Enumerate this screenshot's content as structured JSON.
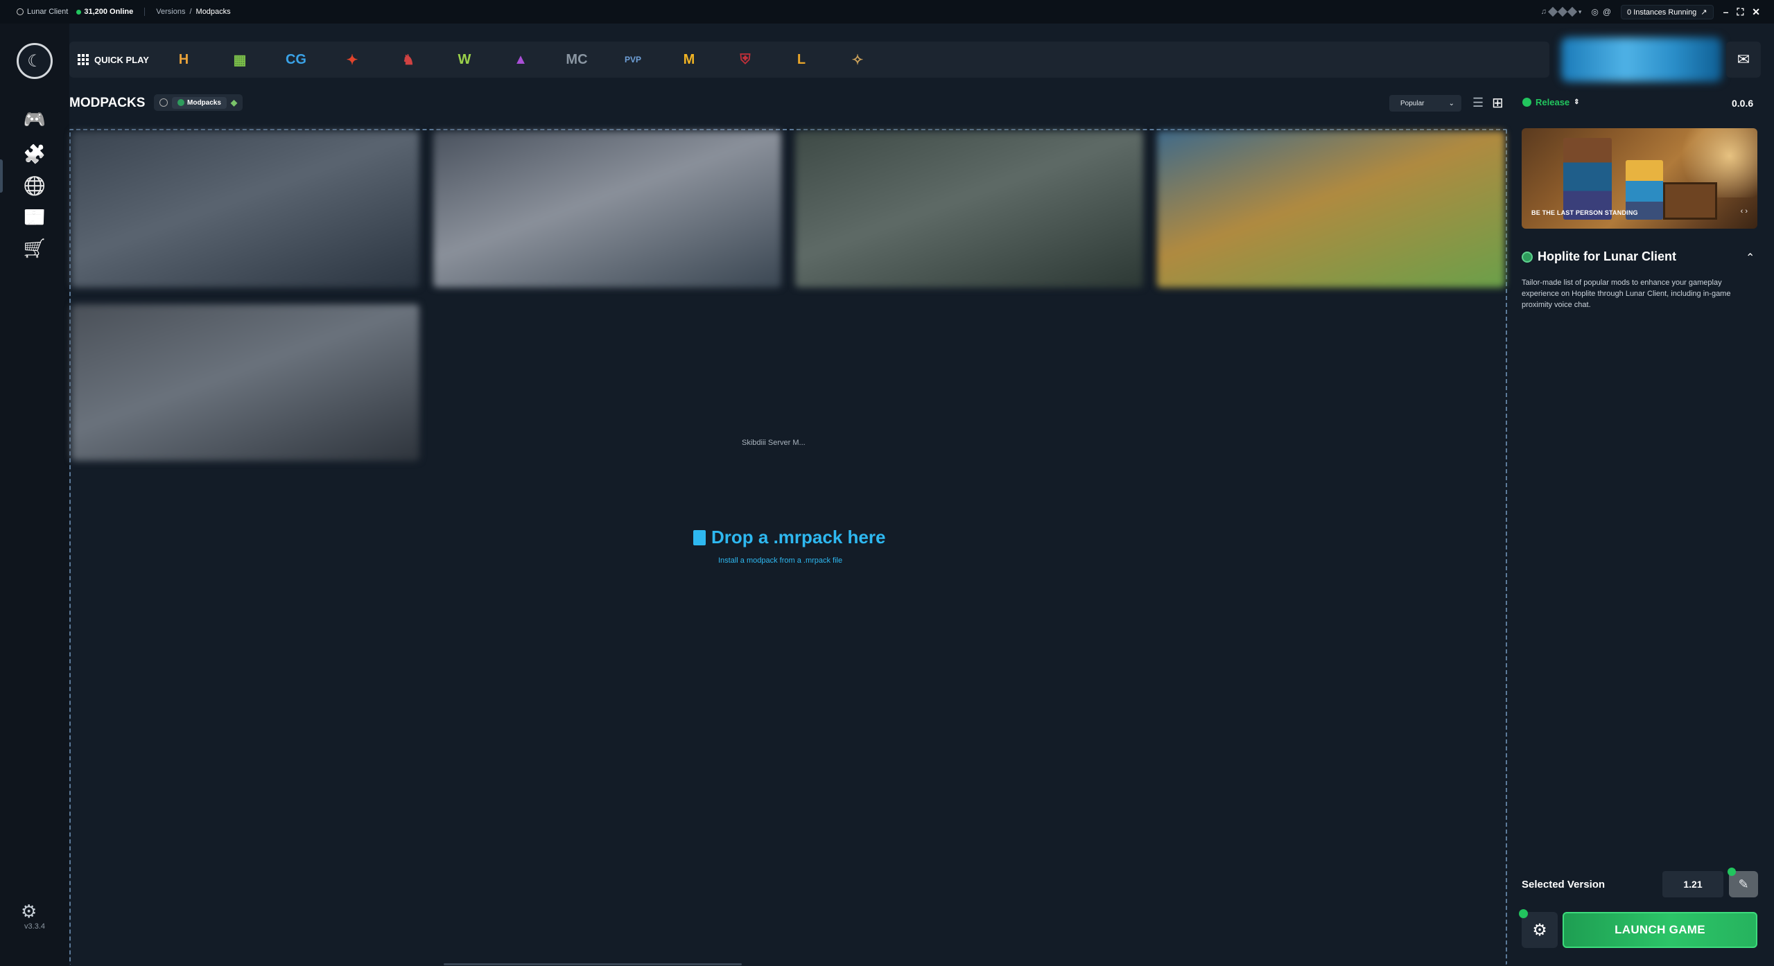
{
  "titlebar": {
    "app_name": "Lunar Client",
    "online": "31,200 Online",
    "breadcrumb": [
      "Versions",
      "/",
      "Modpacks"
    ],
    "instances": "0 Instances Running"
  },
  "sidebar": {
    "items": [
      {
        "name": "games",
        "icon": "gamepad-icon",
        "glyph": "🎮"
      },
      {
        "name": "mods",
        "icon": "puzzle-icon",
        "glyph": "🧩"
      },
      {
        "name": "servers",
        "icon": "globe-icon",
        "glyph": "🌐"
      },
      {
        "name": "news",
        "icon": "newspaper-icon",
        "glyph": "📰"
      },
      {
        "name": "store",
        "icon": "cart-icon",
        "glyph": "🛒"
      }
    ],
    "version": "v3.3.4"
  },
  "serverbar": {
    "quickplay_label": "QUICK PLAY",
    "servers": [
      {
        "label": "H",
        "color": "#e8a23a",
        "bg": "transparent"
      },
      {
        "label": "▦",
        "color": "#7dc24a",
        "bg": "transparent"
      },
      {
        "label": "CG",
        "color": "#3aa2e6",
        "bg": "transparent"
      },
      {
        "label": "✦",
        "color": "#e0442c",
        "bg": "transparent"
      },
      {
        "label": "♞",
        "color": "#d04242",
        "bg": "transparent"
      },
      {
        "label": "W",
        "color": "#9bd14a",
        "bg": "transparent"
      },
      {
        "label": "▲",
        "color": "#a94fd6",
        "bg": "transparent"
      },
      {
        "label": "MC",
        "color": "#8a96a2",
        "bg": "transparent"
      },
      {
        "label": "PVP",
        "color": "#6fa0d8",
        "bg": "transparent"
      },
      {
        "label": "M",
        "color": "#f0b323",
        "bg": "transparent"
      },
      {
        "label": "⛨",
        "color": "#c4303a",
        "bg": "transparent"
      },
      {
        "label": "L",
        "color": "#e8a52a",
        "bg": "transparent"
      },
      {
        "label": "✧",
        "color": "#c9a05a",
        "bg": "transparent"
      }
    ]
  },
  "main": {
    "title": "MODPACKS",
    "tab_active": "Modpacks",
    "sort_value": "Popular",
    "cards": [
      {
        "colors": [
          "#3a4450",
          "#5a6470",
          "#2a3440"
        ]
      },
      {
        "colors": [
          "#4a525e",
          "#8a909a",
          "#3a4652"
        ]
      },
      {
        "colors": [
          "#3e4a46",
          "#5e6a66",
          "#2c3834"
        ]
      },
      {
        "colors": [
          "#3f6a8a",
          "#b08a40",
          "#6aa04a"
        ]
      },
      {
        "colors": [
          "#4a5058",
          "#6a727c",
          "#2e343c"
        ]
      }
    ],
    "card_label": "Skibdiii Server M...",
    "drop_title": "Drop a .mrpack here",
    "drop_subtitle": "Install a modpack from a .mrpack file"
  },
  "panel": {
    "channel": "Release",
    "version": "0.0.6",
    "banner_text": "BE THE LAST PERSON STANDING",
    "banner_nav": "‹ ›",
    "pack_title": "Hoplite for Lunar Client",
    "pack_description": "Tailor-made list of popular mods to enhance your gameplay experience on Hoplite through Lunar Client, including in-game proximity voice chat.",
    "selected_version_label": "Selected Version",
    "selected_version": "1.21",
    "launch_label": "LAUNCH GAME"
  }
}
